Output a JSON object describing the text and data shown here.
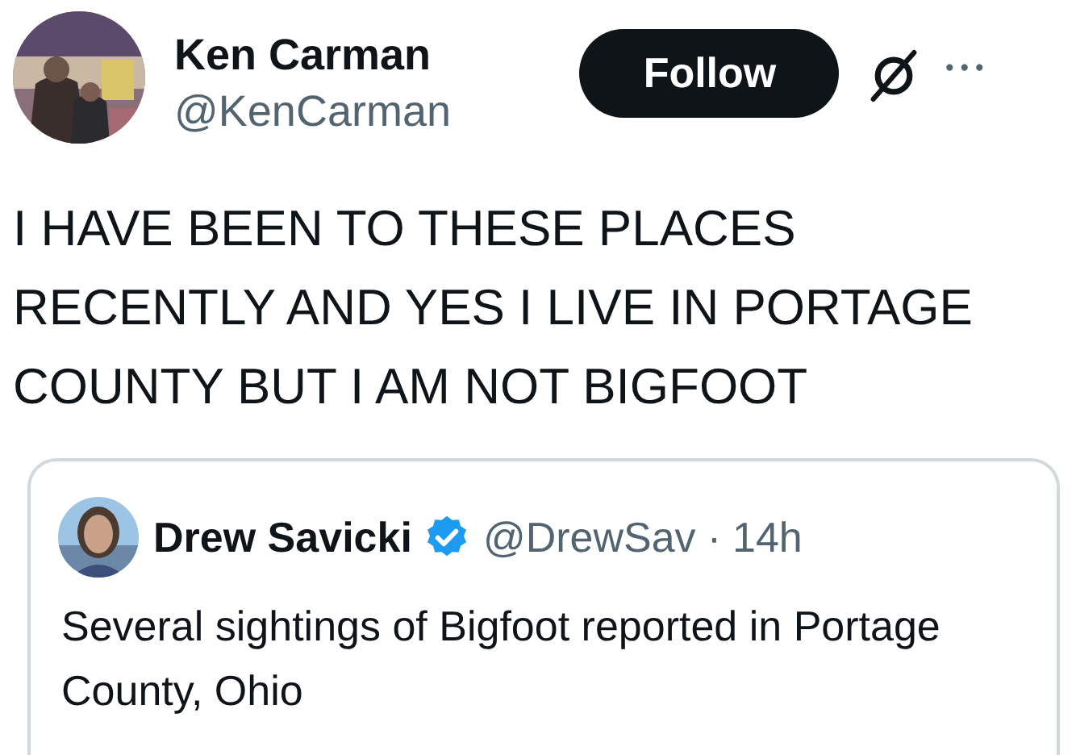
{
  "author": {
    "name": "Ken Carman",
    "handle": "@KenCarman"
  },
  "follow_button": "Follow",
  "more_button": "•••",
  "body": "I HAVE BEEN TO THESE PLACES RECENTLY AND YES I LIVE IN PORTAGE COUNTY BUT I AM NOT BIGFOOT",
  "quoted_post": {
    "name": "Drew Savicki",
    "verified": true,
    "handle": "@DrewSav",
    "separator": "·",
    "time": "14h",
    "text": "Several sightings of Bigfoot reported in Portage County, Ohio"
  }
}
